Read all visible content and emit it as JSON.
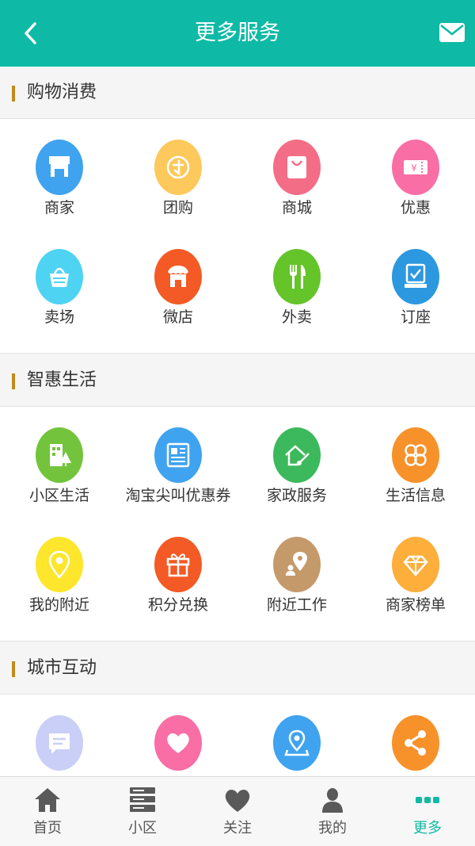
{
  "colors": {
    "header": "#0ebaa6",
    "accent_active": "#0ebaa6",
    "section_bar": "#c28a1c"
  },
  "header": {
    "title": "更多服务",
    "back_icon": "chevron-left-icon",
    "mail_icon": "mail-icon"
  },
  "sections": [
    {
      "title": "购物消费",
      "items": [
        {
          "label": "商家",
          "icon": "shop-icon",
          "color": "#3fa3ef"
        },
        {
          "label": "团购",
          "icon": "group-buy-icon",
          "color": "#fdc95c"
        },
        {
          "label": "商城",
          "icon": "shopping-bag-icon",
          "color": "#f46d86"
        },
        {
          "label": "优惠",
          "icon": "coupon-icon",
          "color": "#f86ea5"
        },
        {
          "label": "卖场",
          "icon": "basket-icon",
          "color": "#4fd3f2"
        },
        {
          "label": "微店",
          "icon": "micro-store-icon",
          "color": "#f45a25"
        },
        {
          "label": "外卖",
          "icon": "fork-knife-icon",
          "color": "#64c42a"
        },
        {
          "label": "订座",
          "icon": "seat-icon",
          "color": "#2c98df"
        }
      ]
    },
    {
      "title": "智惠生活",
      "items": [
        {
          "label": "小区生活",
          "icon": "community-icon",
          "color": "#73c43c"
        },
        {
          "label": "淘宝尖叫优惠券",
          "icon": "newspaper-icon",
          "color": "#3fa3ef"
        },
        {
          "label": "家政服务",
          "icon": "house-clean-icon",
          "color": "#3cb95c"
        },
        {
          "label": "生活信息",
          "icon": "clover-icon",
          "color": "#f7922a"
        },
        {
          "label": "我的附近",
          "icon": "location-pin-icon",
          "color": "#fde62c"
        },
        {
          "label": "积分兑换",
          "icon": "gift-icon",
          "color": "#f35a25"
        },
        {
          "label": "附近工作",
          "icon": "job-location-icon",
          "color": "#c59a6a"
        },
        {
          "label": "商家榜单",
          "icon": "diamond-icon",
          "color": "#fdae3b"
        }
      ]
    },
    {
      "title": "城市互动",
      "items": [
        {
          "label": "",
          "icon": "message-icon",
          "color": "#c9cff7"
        },
        {
          "label": "",
          "icon": "heart-icon",
          "color": "#f86ea5"
        },
        {
          "label": "",
          "icon": "map-pin-icon",
          "color": "#3fa3ef"
        },
        {
          "label": "",
          "icon": "share-icon",
          "color": "#f7922a"
        }
      ]
    }
  ],
  "tabbar": {
    "items": [
      {
        "label": "首页",
        "icon": "home-icon",
        "active": false
      },
      {
        "label": "小区",
        "icon": "server-stack-icon",
        "active": false
      },
      {
        "label": "关注",
        "icon": "heart-icon",
        "active": false
      },
      {
        "label": "我的",
        "icon": "person-icon",
        "active": false
      },
      {
        "label": "更多",
        "icon": "more-dots-icon",
        "active": true
      }
    ]
  }
}
